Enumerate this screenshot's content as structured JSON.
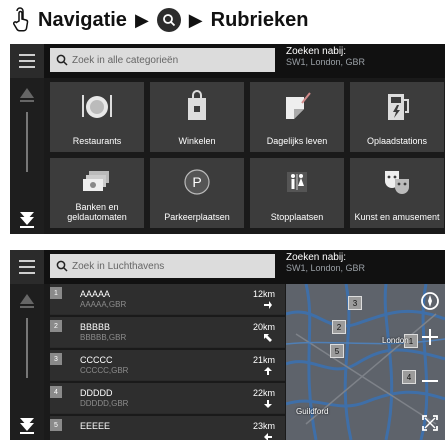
{
  "header": {
    "title_1": "Navigatie",
    "arrow": "▶",
    "title_2": "Rubrieken"
  },
  "screen1": {
    "search_placeholder": "Zoek in alle categorieën",
    "near_title": "Zoeken nabij:",
    "near_location": "SW1, London, GBR",
    "categories": [
      {
        "label": "Restaurants",
        "icon": "restaurant-icon"
      },
      {
        "label": "Winkelen",
        "icon": "shopping-bag-icon"
      },
      {
        "label": "Dagelijks leven",
        "icon": "daily-life-icon"
      },
      {
        "label": "Oplaadstations",
        "icon": "charging-station-icon"
      },
      {
        "label": "Banken en geldautomaten",
        "icon": "bank-atm-icon"
      },
      {
        "label": "Parkeerplaatsen",
        "icon": "parking-icon"
      },
      {
        "label": "Stopplaatsen",
        "icon": "restroom-icon"
      },
      {
        "label": "Kunst en amusement",
        "icon": "theater-masks-icon"
      }
    ]
  },
  "screen2": {
    "search_placeholder": "Zoek in Luchthavens",
    "near_title": "Zoeken nabij:",
    "near_location": "SW1, London, GBR",
    "results": [
      {
        "index": "1",
        "name": "AAAAA",
        "sub": "AAAAA,GBR",
        "distance": "12km",
        "direction": "arrow-right-icon"
      },
      {
        "index": "2",
        "name": "BBBBB",
        "sub": "BBBBB,GBR",
        "distance": "20km",
        "direction": "arrow-up-left-icon"
      },
      {
        "index": "3",
        "name": "CCCCC",
        "sub": "CCCCC,GBR",
        "distance": "21km",
        "direction": "arrow-up-icon"
      },
      {
        "index": "4",
        "name": "DDDDD",
        "sub": "DDDDD,GBR",
        "distance": "22km",
        "direction": "arrow-down-icon"
      },
      {
        "index": "5",
        "name": "EEEEE",
        "sub": "",
        "distance": "23km",
        "direction": "arrow-left-icon"
      }
    ],
    "map": {
      "city_london": "London",
      "city_guildford": "Guildford",
      "pins": [
        "1",
        "2",
        "3",
        "4",
        "5"
      ],
      "callout_pin": "1"
    }
  }
}
